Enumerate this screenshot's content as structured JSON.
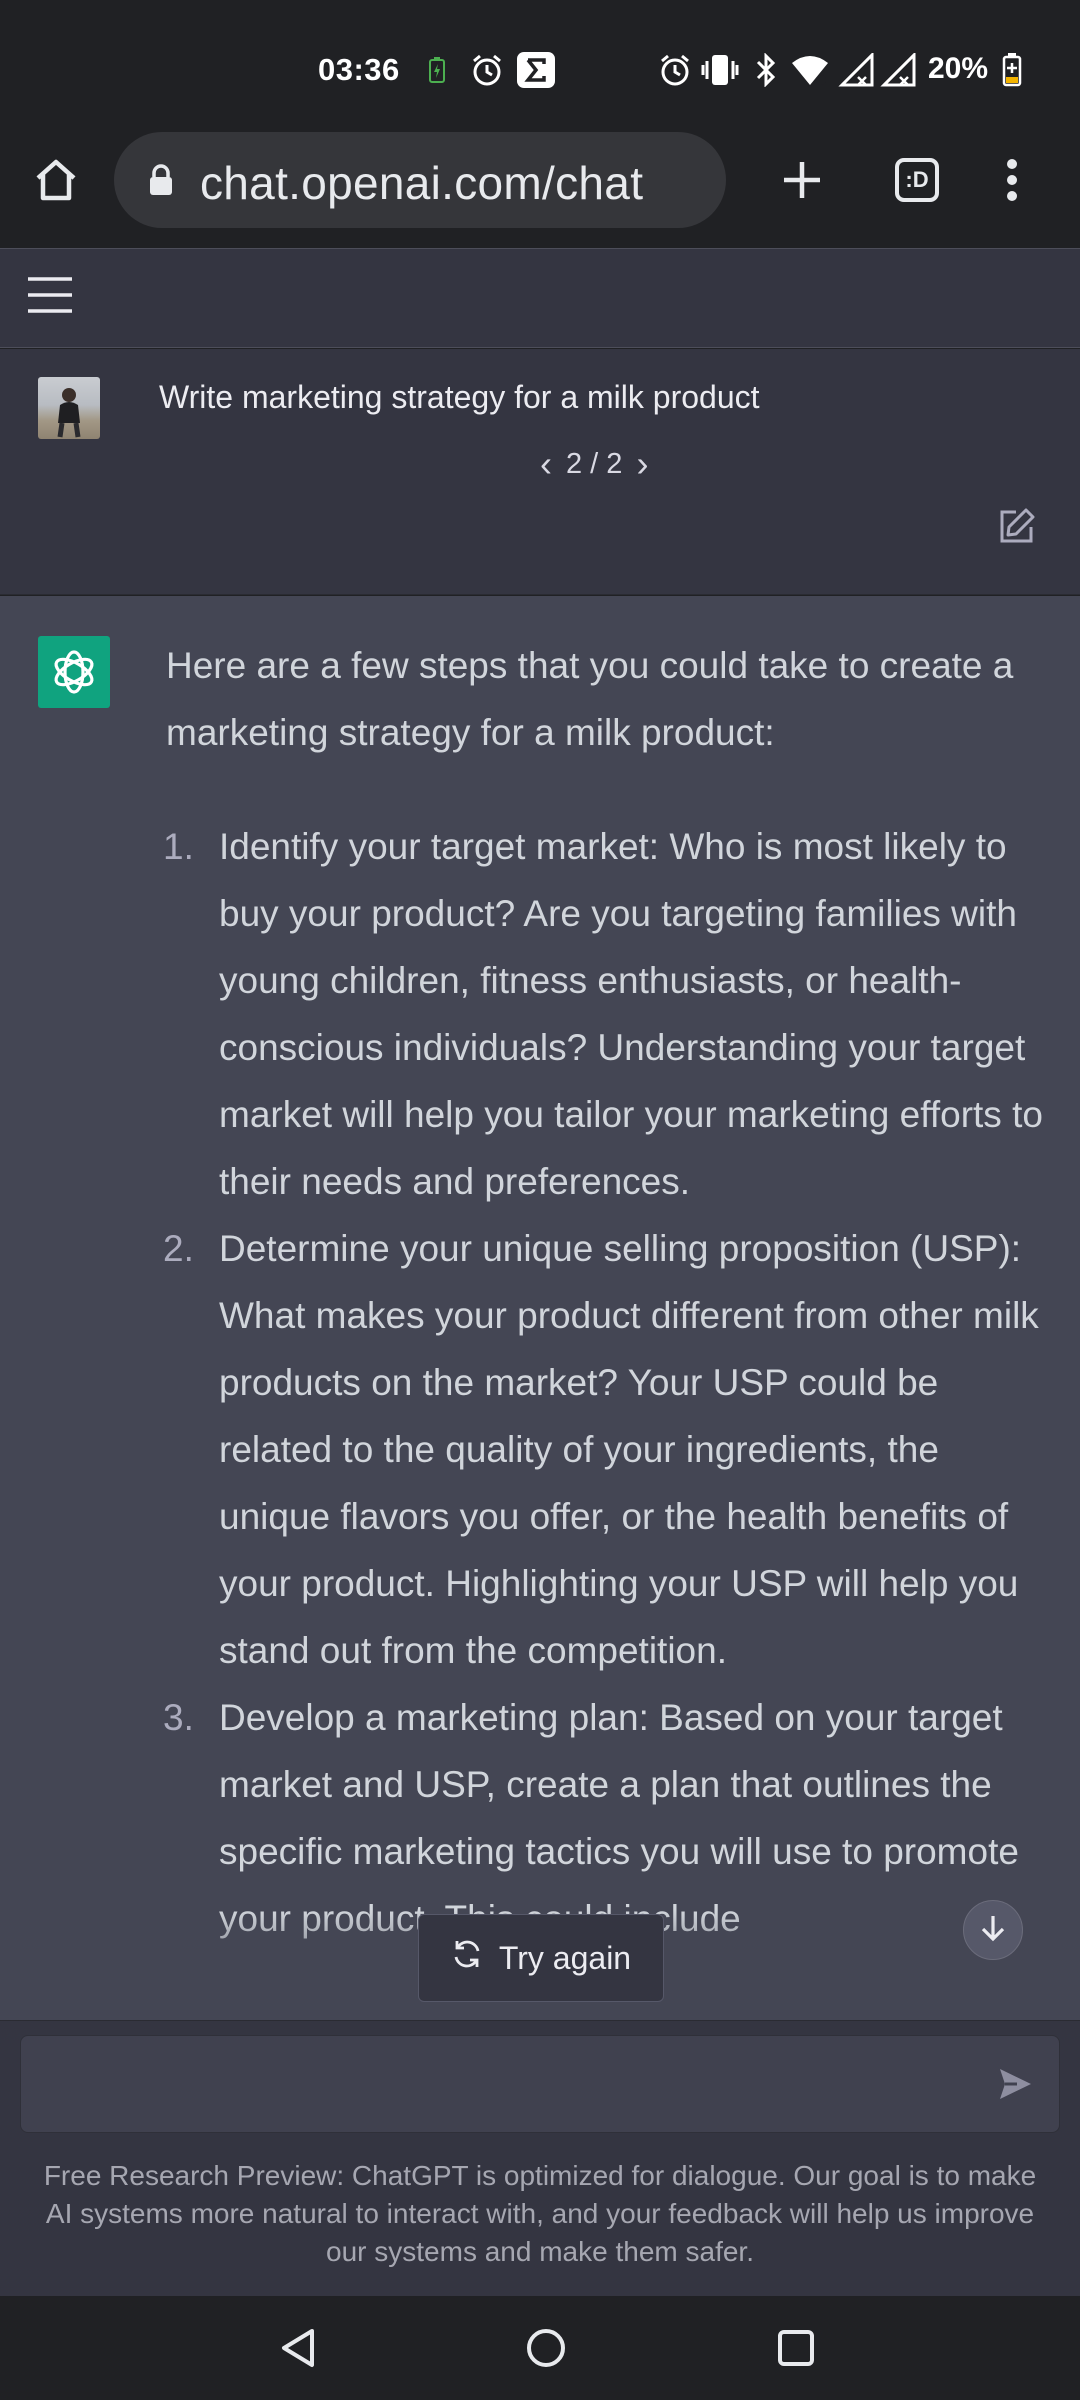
{
  "status_bar": {
    "time": "03:36",
    "battery_percent": "20%",
    "icons": [
      "battery-charging-icon",
      "alarm-icon",
      "sigma-app-icon",
      "alarm-icon",
      "vibrate-icon",
      "bluetooth-icon",
      "wifi-icon",
      "signal-icon",
      "signal-icon",
      "battery-icon"
    ]
  },
  "browser": {
    "url": "chat.openai.com/chat",
    "buttons": [
      "home-icon",
      "new-tab-icon",
      "tab-switcher-icon",
      "more-menu-icon"
    ],
    "tab_switcher_label": ":D"
  },
  "chat": {
    "user_prompt": "Write marketing strategy for a milk product",
    "pager": "2 / 2",
    "pager_prev": "‹",
    "pager_next": "›",
    "assistant": {
      "intro": "Here are a few steps that you could take to create a marketing strategy for a milk product:",
      "items": [
        {
          "num": "1.",
          "text": "Identify your target market: Who is most likely to buy your product? Are you targeting families with young children, fitness enthusiasts, or health-conscious individuals? Understanding your target market will help you tailor your marketing efforts to their needs and preferences."
        },
        {
          "num": "2.",
          "text": "Determine your unique selling proposition (USP): What makes your product different from other milk products on the market? Your USP could be related to the quality of your ingredients, the unique flavors you offer, or the health benefits of your product. Highlighting your USP will help you stand out from the competition."
        },
        {
          "num": "3.",
          "text": "Develop a marketing plan: Based on your target market and USP, create a plan that outlines the specific marketing tactics you will use to promote your product. This could include"
        }
      ]
    },
    "try_again_label": "Try again"
  },
  "composer": {
    "placeholder": "",
    "disclaimer": "Free Research Preview: ChatGPT is optimized for dialogue. Our goal is to make AI systems more natural to interact with, and your feedback will help us improve our systems and make them safer."
  },
  "colors": {
    "chrome_bg": "#202124",
    "chat_bg": "#343541",
    "assistant_bg": "#444654",
    "openai_green": "#10a37f"
  }
}
